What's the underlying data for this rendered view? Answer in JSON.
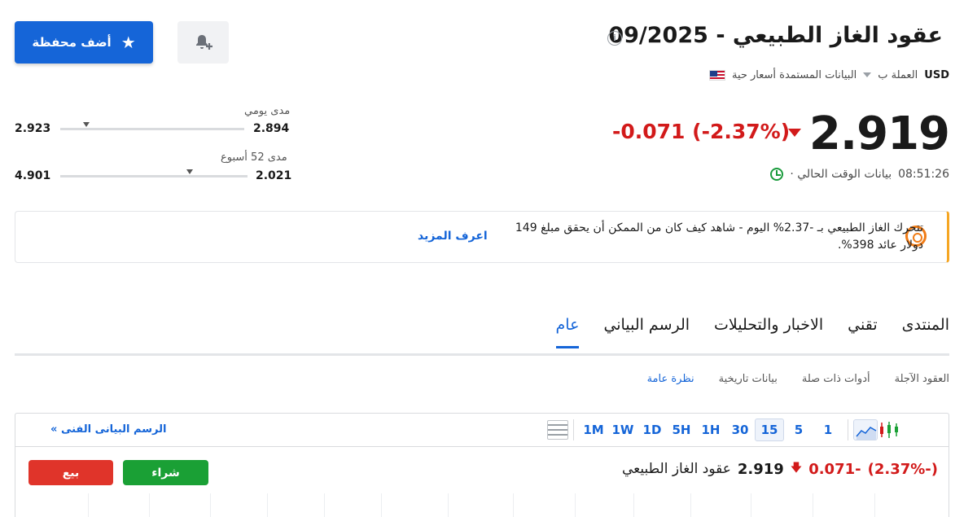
{
  "header": {
    "title": "عقود الغاز الطبيعي - 09/2025",
    "info_icon": "i",
    "data_source": "البيانات المستمدة أسعار حية",
    "currency_prefix": "العملة ب",
    "currency": "USD",
    "flag_icon": "us-flag-icon"
  },
  "actions": {
    "portfolio_label": "أضف محفظة",
    "portfolio_icon": "star-icon",
    "alert_icon": "bell-plus-icon"
  },
  "quote": {
    "price": "2.919",
    "change": "-0.071 (-2.37%)",
    "direction": "down",
    "time_label": "بيانات الوقت الحالي ·",
    "time": "08:51:26",
    "colors": {
      "down": "#d21a1a",
      "accent": "#1565d8",
      "buy": "#1aa035",
      "sell": "#e0342a"
    }
  },
  "ranges": {
    "daily": {
      "label": "مدى يومي",
      "low": "2.894",
      "high": "2.923",
      "position": 0.88
    },
    "week52": {
      "label": "مدى 52 أسبوع",
      "low": "2.021",
      "high": "4.901",
      "position": 0.31
    }
  },
  "promo": {
    "text": "تتحرك الغاز الطبيعي بـ -2.37% اليوم - شاهد كيف كان من الممكن أن يحقق مبلغ 149 دولار عائد 398%.",
    "link": "اعرف المزيد"
  },
  "tabs": [
    {
      "label": "عام",
      "active": true
    },
    {
      "label": "الرسم البياني",
      "active": false
    },
    {
      "label": "الاخبار والتحليلات",
      "active": false
    },
    {
      "label": "تقني",
      "active": false
    },
    {
      "label": "المنتدى",
      "active": false
    }
  ],
  "subtabs": [
    {
      "label": "نظرة عامة",
      "active": true
    },
    {
      "label": "بيانات تاريخية",
      "active": false
    },
    {
      "label": "أدوات ذات صلة",
      "active": false
    },
    {
      "label": "العقود الآجلة",
      "active": false
    }
  ],
  "chart_widget": {
    "timeframes": [
      "1M",
      "1W",
      "1D",
      "5H",
      "1H",
      "30",
      "15",
      "5",
      "1"
    ],
    "selected_timeframe": "15",
    "tech_chart_link": "الرسم البيانى الفنى",
    "instrument_name": "عقود الغاز الطبيعي",
    "instrument_price": "2.919",
    "instrument_change": "-0.071",
    "instrument_change_pct": "(-2.37%)",
    "buy_label": "شراء",
    "sell_label": "بيع"
  }
}
